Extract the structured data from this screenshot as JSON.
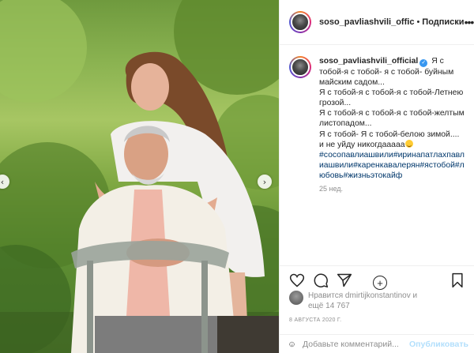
{
  "header": {
    "username": "soso_pavliashvili_offic",
    "separator": "•",
    "follow_label": "Подписки",
    "more_icon": "more-options-icon"
  },
  "caption": {
    "username": "soso_pavliashvili_official",
    "verified_mark": "✓",
    "lines": [
      "Я с тобой-я с тобой- я с тобой- буйным майским садом...",
      "Я с тобой-я с тобой-я с тобой-Летнею грозой...",
      "Я с тобой-я с тобой-я с тобой-желтым листопадом...",
      "Я с тобой- Я с тобой-белою зимой....",
      "и не уйду никогдааааа"
    ],
    "hashtags": "#сосопавлиашвили#иринапатлахпавлиашвили#каренкавалерян#ястобой#любовь#жизньэтокайф",
    "time": "25 нед."
  },
  "load_more_symbol": "+",
  "actions": {
    "like_icon": "heart-icon",
    "comment_icon": "comment-icon",
    "share_icon": "share-icon",
    "save_icon": "bookmark-icon"
  },
  "likes": {
    "prefix": "Нравится",
    "user": "dmirtijkonstantinov",
    "middle": "и",
    "count_text": "ещё 14 767"
  },
  "post_date": "8 АВГУСТА 2020 Г.",
  "comment": {
    "placeholder": "Добавьте комментарий...",
    "publish_label": "Опубликовать"
  },
  "photo": {
    "nav_left": "‹",
    "nav_right": "›"
  },
  "colors": {
    "link": "#00376b",
    "verified": "#3897f0",
    "muted": "#8e8e8e",
    "publish_disabled": "#b2dffc"
  }
}
